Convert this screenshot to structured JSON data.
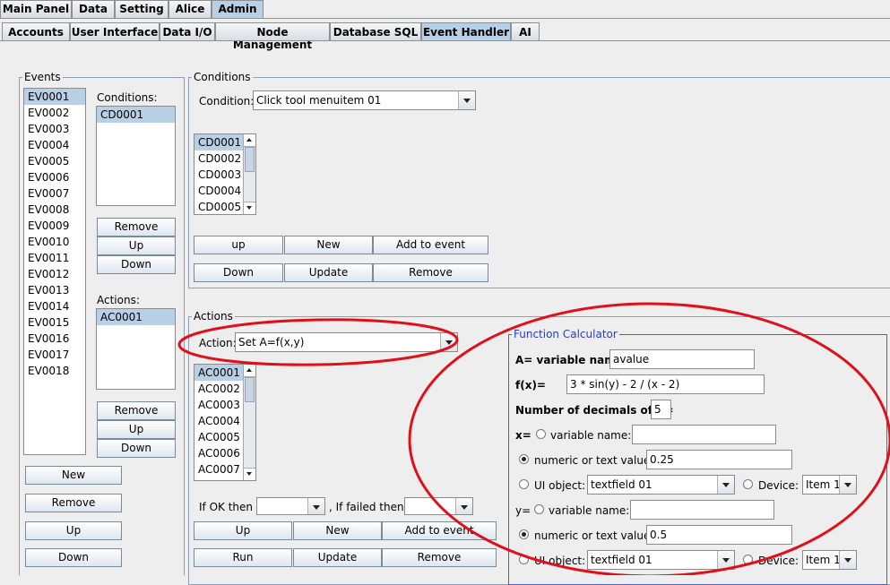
{
  "main_tabs": [
    "Main Panel",
    "Data",
    "Setting",
    "Alice",
    "Admin"
  ],
  "sub_tabs": [
    "Accounts",
    "User Interface",
    "Data I/O",
    "Node Management",
    "Database SQL",
    "Event Handler",
    "AI"
  ],
  "events": {
    "legend": "Events",
    "items": [
      "EV0001",
      "EV0002",
      "EV0003",
      "EV0004",
      "EV0005",
      "EV0006",
      "EV0007",
      "EV0008",
      "EV0009",
      "EV0010",
      "EV0011",
      "EV0012",
      "EV0013",
      "EV0014",
      "EV0015",
      "EV0016",
      "EV0017",
      "EV0018"
    ],
    "selected": "EV0001",
    "conditions_label": "Conditions:",
    "conditions_items": [
      "CD0001"
    ],
    "actions_label": "Actions:",
    "actions_items": [
      "AC0001"
    ],
    "remove_label": "Remove",
    "up_label": "Up",
    "down_label": "Down",
    "new_label": "New"
  },
  "conditions": {
    "legend": "Conditions",
    "condition_label": "Condition:",
    "condition_value": "Click tool menuitem 01",
    "items": [
      "CD0001",
      "CD0002",
      "CD0003",
      "CD0004",
      "CD0005"
    ],
    "up_label": "up",
    "new_label": "New",
    "add_label": "Add to event",
    "down_label": "Down",
    "update_label": "Update",
    "remove_label": "Remove"
  },
  "actions": {
    "legend": "Actions",
    "action_label": "Action:",
    "action_value": "Set A=f(x,y)",
    "items": [
      "AC0001",
      "AC0002",
      "AC0003",
      "AC0004",
      "AC0005",
      "AC0006",
      "AC0007"
    ],
    "if_ok_label": "If OK  then",
    "if_failed_label": ", If failed  then",
    "up_label": "Up",
    "new_label": "New",
    "add_label": "Add to event",
    "run_label": "Run",
    "update_label": "Update",
    "remove_label": "Remove"
  },
  "calculator": {
    "legend": "Function Calculator",
    "a_label": "A= variable name:",
    "a_value": "avalue",
    "fx_label": "f(x)=",
    "fx_value": "3 * sin(y) - 2 / (x - 2)",
    "decimals_label": "Number of decimals of A=",
    "decimals_value": "5",
    "x_label": "x=",
    "y_label": "y=",
    "variable_name_label": "variable name:",
    "numeric_label": "numeric  or text value:",
    "x_numeric_value": "0.25",
    "y_numeric_value": "0.5",
    "ui_object_label": "UI object:",
    "ui_object_value": "textfield 01",
    "device_label": "Device:",
    "device_value": "Item 1"
  },
  "annotation_color": "#e0101a",
  "selection_color": "#b8cfe5"
}
